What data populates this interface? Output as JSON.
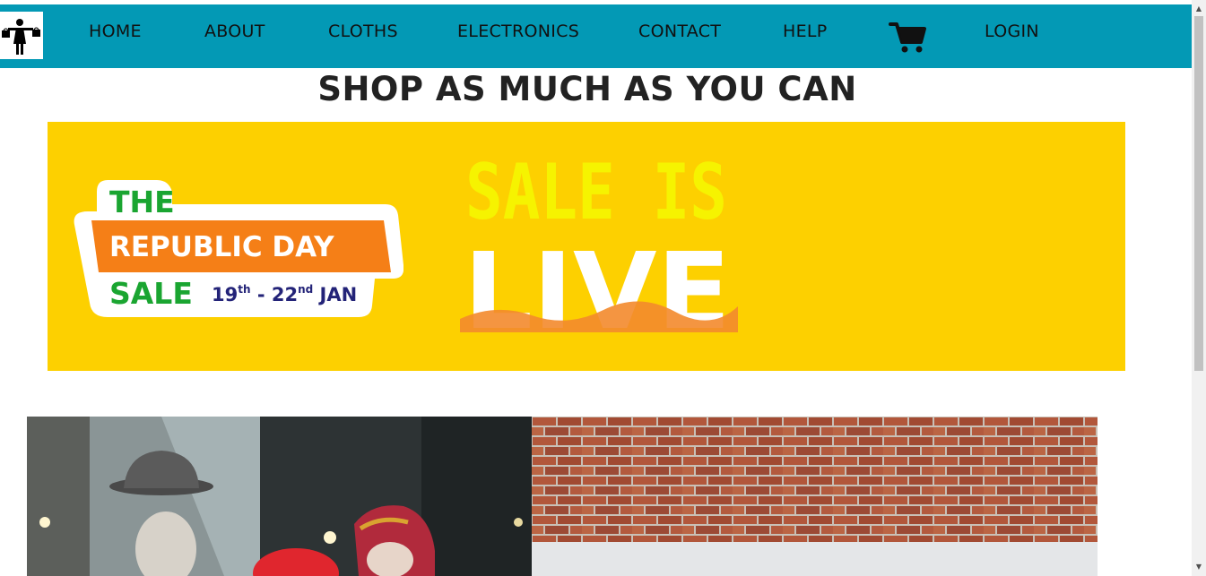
{
  "nav": {
    "logo_icon": "shopper-figure-icon",
    "items": [
      {
        "label": "HOME"
      },
      {
        "label": "ABOUT"
      },
      {
        "label": "CLOTHS"
      },
      {
        "label": "ELECTRONICS"
      },
      {
        "label": "CONTACT"
      },
      {
        "label": "HELP"
      },
      {
        "label": "LOGIN"
      }
    ],
    "cart_icon": "shopping-cart-icon"
  },
  "headline": "SHOP AS MUCH AS YOU CAN",
  "banner": {
    "badge_line1": "THE",
    "badge_line2": "REPUBLIC DAY",
    "badge_line3": "SALE",
    "dates_day1": "19",
    "dates_sup1": "th",
    "dates_sep": " - ",
    "dates_day2": "22",
    "dates_sup2": "nd",
    "dates_month": " JAN",
    "live_line1": "SALE IS",
    "live_line2": "LIVE"
  },
  "colors": {
    "navbar": "#0399b5",
    "banner": "#fdd000",
    "badge_orange": "#f57f17",
    "badge_green": "#1aa531",
    "date_navy": "#232378"
  }
}
